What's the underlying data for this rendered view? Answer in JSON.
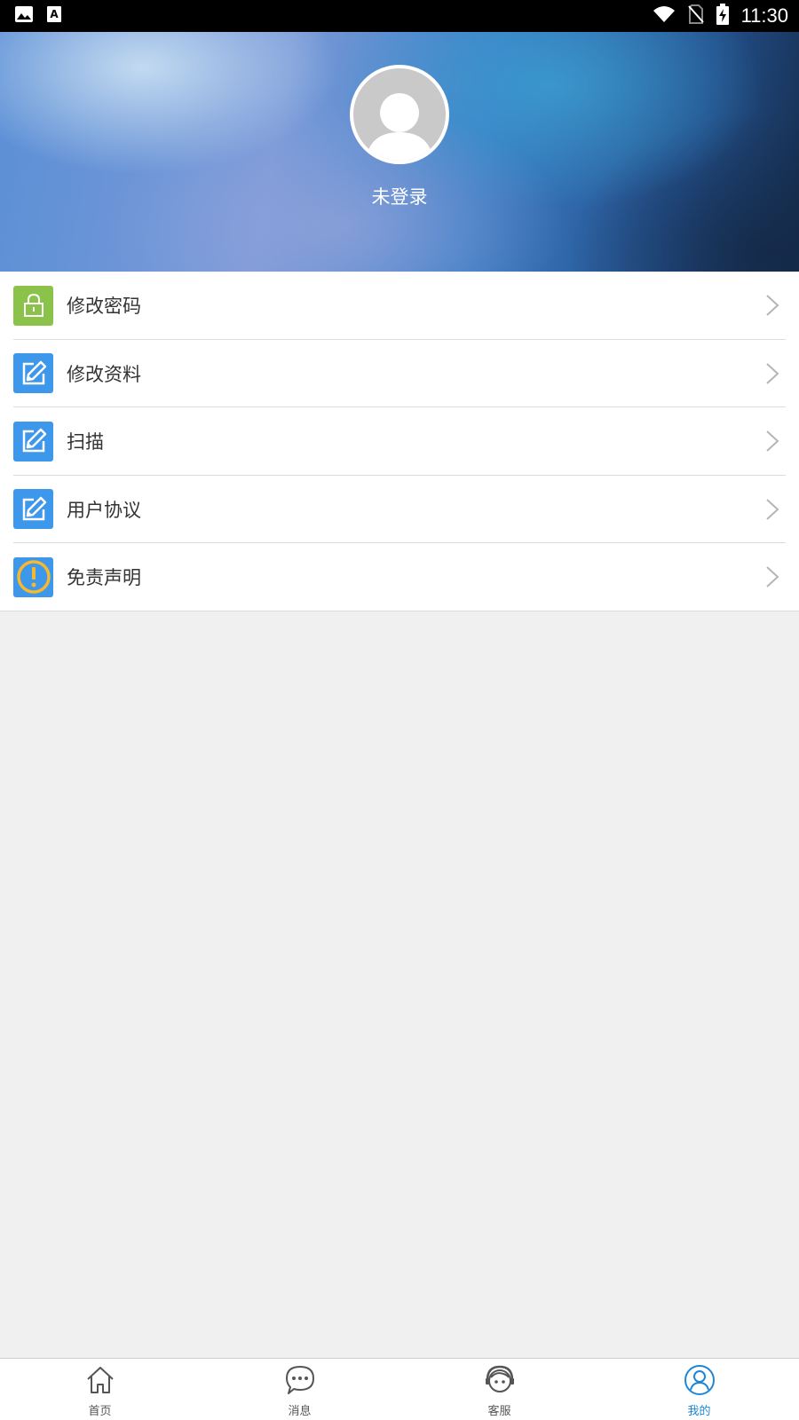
{
  "status_bar": {
    "time": "11:30",
    "left_icons": [
      "image-icon",
      "text-a-icon"
    ],
    "right_icons": [
      "wifi-icon",
      "no-sim-icon",
      "battery-charging-icon"
    ]
  },
  "header": {
    "avatar_icon": "default-avatar-icon",
    "username": "未登录"
  },
  "menu": {
    "items": [
      {
        "label": "修改密码",
        "icon": "lock-icon",
        "icon_color": "#8bc34a"
      },
      {
        "label": "修改资料",
        "icon": "edit-icon",
        "icon_color": "#3d97eb"
      },
      {
        "label": "扫描",
        "icon": "edit-icon",
        "icon_color": "#3d97eb"
      },
      {
        "label": "用户协议",
        "icon": "edit-icon",
        "icon_color": "#3d97eb"
      },
      {
        "label": "免责声明",
        "icon": "warning-icon",
        "icon_color": "#3d97eb"
      }
    ]
  },
  "bottom_nav": {
    "items": [
      {
        "label": "首页",
        "icon": "home-icon"
      },
      {
        "label": "消息",
        "icon": "message-icon"
      },
      {
        "label": "客服",
        "icon": "customer-service-icon"
      },
      {
        "label": "我的",
        "icon": "user-icon",
        "active": true
      }
    ],
    "active_color": "#1f86d6"
  }
}
